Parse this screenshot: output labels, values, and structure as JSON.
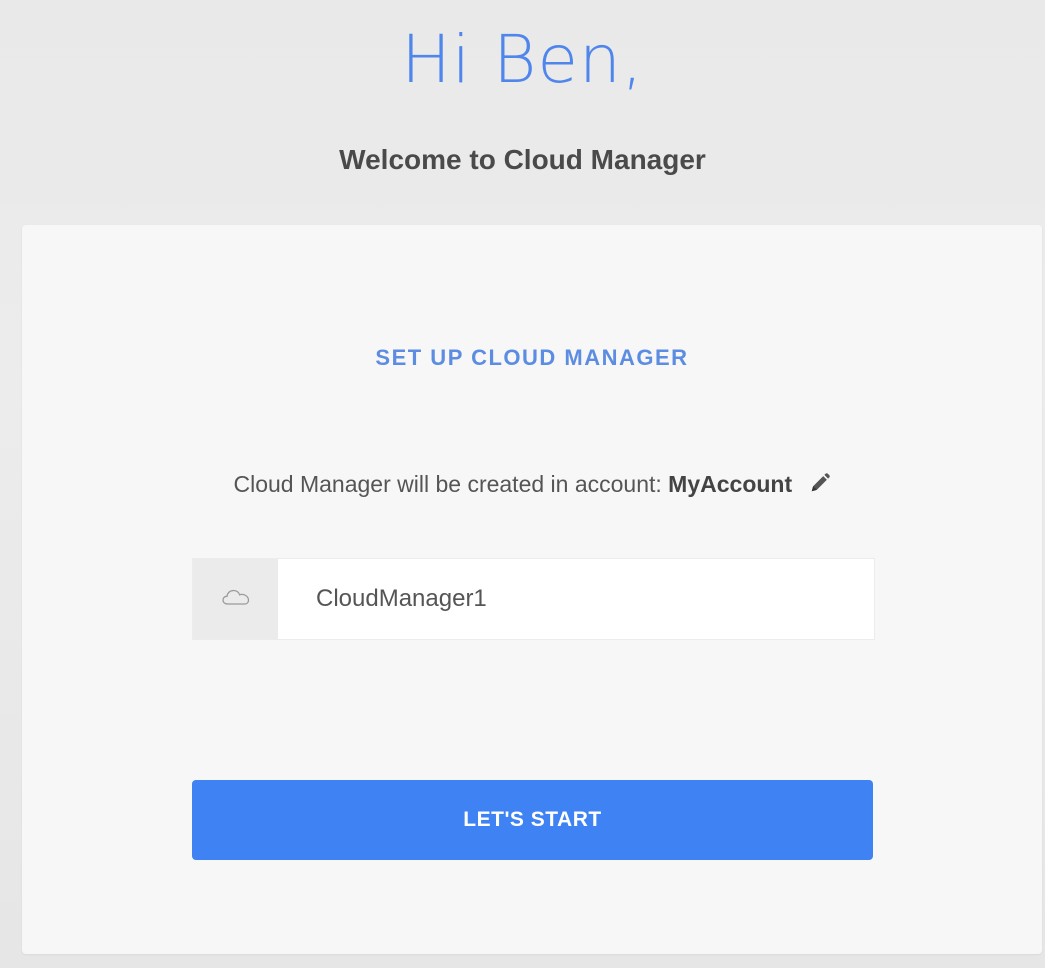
{
  "header": {
    "greeting": "Hi Ben,",
    "welcome": "Welcome to Cloud Manager"
  },
  "setup": {
    "title": "SET UP CLOUD MANAGER",
    "account_prefix": "Cloud Manager will be created in account:",
    "account_name": "MyAccount",
    "edit_icon": "pencil-icon",
    "name_field": {
      "icon": "cloud-icon",
      "value": "CloudManager1"
    },
    "start_button_label": "LET'S START"
  },
  "colors": {
    "accent": "#4f86ec",
    "button": "#3e82f3",
    "title": "#5c8de2"
  }
}
